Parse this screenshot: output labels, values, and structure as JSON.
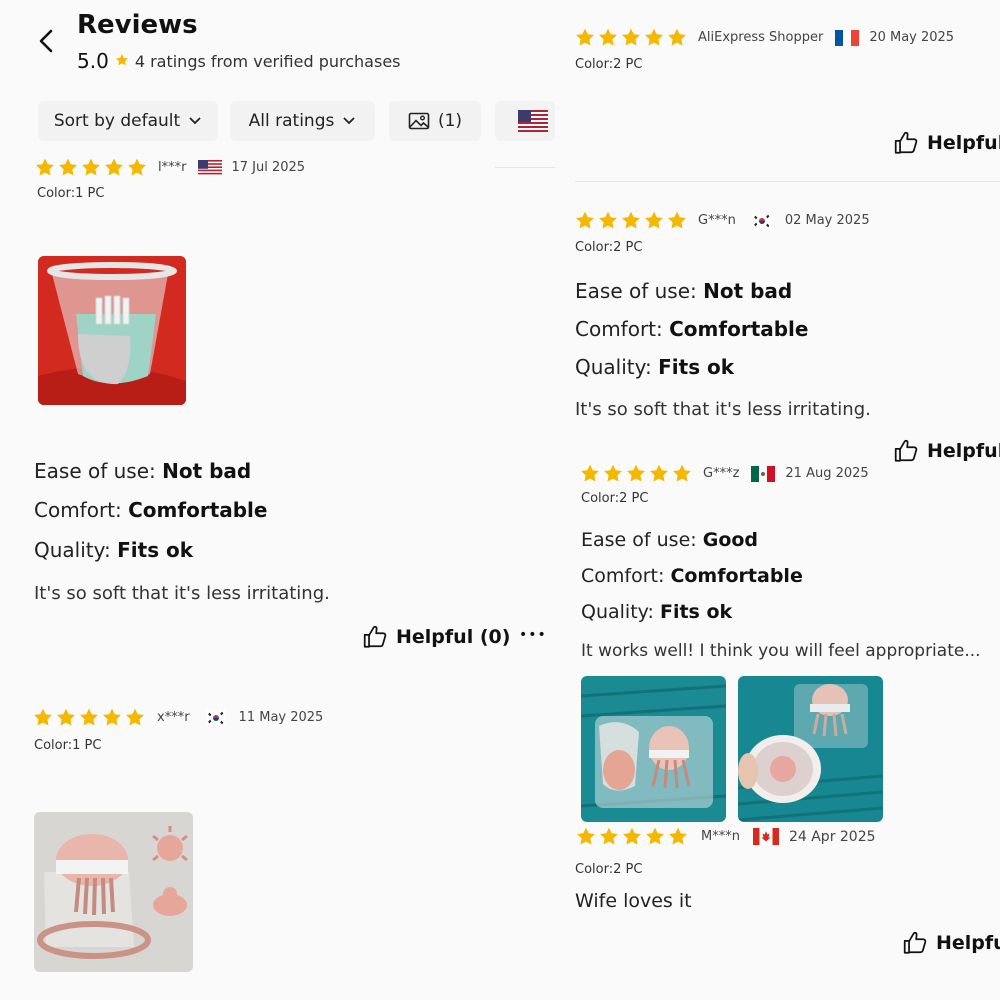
{
  "header": {
    "title": "Reviews",
    "rating": "5.0",
    "rating_text": "4 ratings from verified purchases"
  },
  "filters": {
    "sort_label": "Sort by default",
    "ratings_label": "All ratings",
    "photo_count": "(1)"
  },
  "left_reviews": [
    {
      "user": "l***r",
      "date": "17 Jul 2025",
      "color": "Color:1 PC",
      "ease_label": "Ease of use:",
      "ease_value": "Not bad",
      "comfort_label": "Comfort:",
      "comfort_value": "Comfortable",
      "quality_label": "Quality:",
      "quality_value": "Fits ok",
      "text": "It's so soft that it's less irritating.",
      "helpful": "Helpful (0)",
      "more": "•••"
    },
    {
      "user": "x***r",
      "date": "11 May 2025",
      "color": "Color:1 PC"
    }
  ],
  "right_reviews": [
    {
      "user": "AliExpress Shopper",
      "date": "20 May 2025",
      "color": "Color:2 PC",
      "helpful": "Helpful"
    },
    {
      "user": "G***n",
      "date": "02 May 2025",
      "color": "Color:2 PC",
      "ease_label": "Ease of use:",
      "ease_value": "Not bad",
      "comfort_label": "Comfort:",
      "comfort_value": "Comfortable",
      "quality_label": "Quality:",
      "quality_value": "Fits ok",
      "text": "It's so soft that it's less irritating.",
      "helpful": "Helpful"
    },
    {
      "user": "G***z",
      "date": "21 Aug 2025",
      "color": "Color:2 PC",
      "ease_label": "Ease of use:",
      "ease_value": "Good",
      "comfort_label": "Comfort:",
      "comfort_value": "Comfortable",
      "quality_label": "Quality:",
      "quality_value": "Fits ok",
      "text": "It works well! I think you will feel appropriate..."
    },
    {
      "user": "M***n",
      "date": "24 Apr 2025",
      "color": "Color:2 PC",
      "text": "Wife loves it",
      "helpful": "Helpful"
    }
  ],
  "colors": {
    "star": "#f5b800",
    "text": "#111111",
    "muted": "#444444",
    "background": "#fafafa"
  },
  "icons": {
    "back": "chevron-left-icon",
    "star": "star-icon",
    "dropdown": "chevron-down-icon",
    "image": "image-icon",
    "helpful": "thumbs-up-icon",
    "more": "more-icon"
  }
}
